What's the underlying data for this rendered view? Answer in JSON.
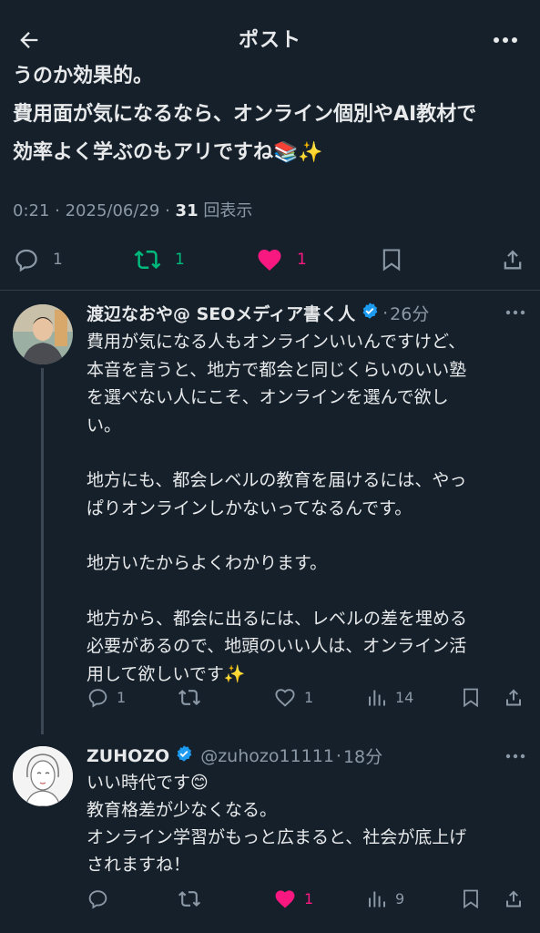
{
  "header": {
    "title": "ポスト",
    "back_icon": "arrow-left-icon",
    "more_icon": "more-horizontal-icon"
  },
  "main_post": {
    "lines": [
      "うのか効果的。",
      "費用面が気になるなら、オンライン個別やAI教材で",
      "効率よく学ぶのもアリですね📚✨"
    ],
    "time": "0:21",
    "date": "2025/06/29",
    "views_count": "31",
    "views_label": "回表示",
    "replies": "1",
    "reposts": "1",
    "likes": "1"
  },
  "replies": [
    {
      "name": "渡辺なおや@ SEOメディア書く人",
      "separator": "·",
      "time": "26分",
      "lines": [
        "費用が気になる人もオンラインいいんですけど、",
        "本音を言うと、地方で都会と同じくらいのいい塾",
        "を選べない人にこそ、オンラインを選んで欲し",
        "い。",
        "",
        "地方にも、都会レベルの教育を届けるには、やっ",
        "ぱりオンラインしかないってなるんです。",
        "",
        "地方いたからよくわかります。",
        "",
        "地方から、都会に出るには、レベルの差を埋める",
        "必要があるので、地頭のいい人は、オンライン活",
        "用して欲しいです✨"
      ],
      "replies": "1",
      "reposts": "",
      "likes": "1",
      "views": "14"
    },
    {
      "name": "ZUHOZO",
      "handle": "@zuhozo11111",
      "separator": "·",
      "time": "18分",
      "lines": [
        "いい時代です😊",
        "教育格差が少なくなる。",
        "オンライン学習がもっと広まると、社会が底上げ",
        "されますね！"
      ],
      "replies": "",
      "reposts": "",
      "likes": "1",
      "views": "9"
    }
  ],
  "colors": {
    "background": "#15202b",
    "text": "#e7e9ea",
    "muted": "#8b98a5",
    "repost_active": "#00ba7c",
    "like_active": "#f91880",
    "verified": "#1d9bf0"
  }
}
